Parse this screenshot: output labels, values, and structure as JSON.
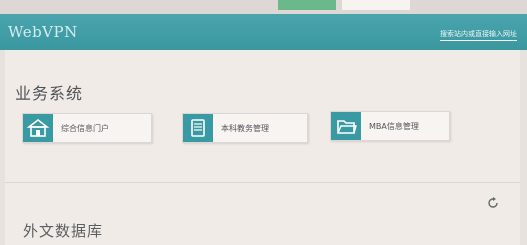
{
  "header": {
    "logo": "WebVPN",
    "link_text": "搜索站内或直接输入网址"
  },
  "business_systems": {
    "title": "业务系统",
    "items": [
      {
        "label": "综合信息门户",
        "icon": "home-icon"
      },
      {
        "label": "本科教务管理",
        "icon": "book-icon"
      },
      {
        "label": "MBA信息管理",
        "icon": "folder-icon"
      }
    ]
  },
  "foreign_db": {
    "title": "外文数据库"
  },
  "colors": {
    "accent": "#3a9aa3",
    "header": "#45a1a9"
  }
}
